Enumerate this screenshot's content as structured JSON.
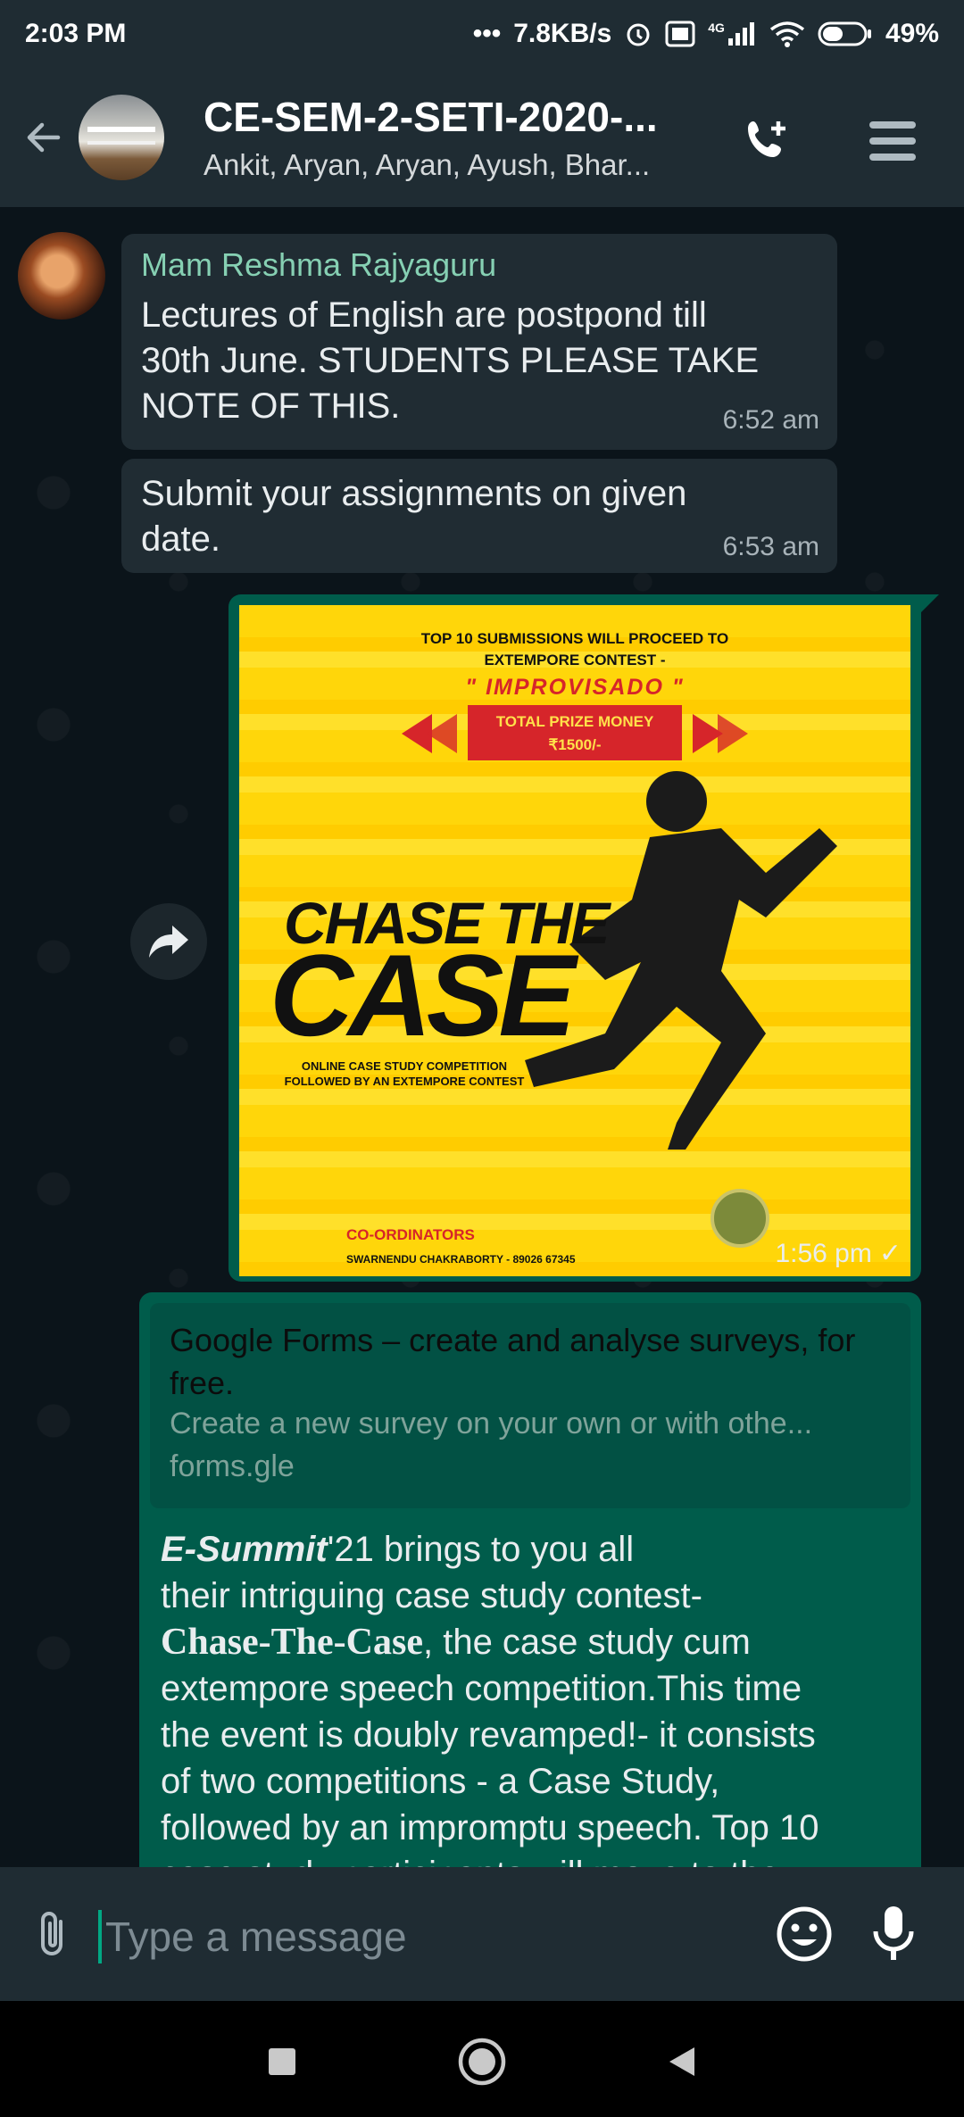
{
  "status_bar": {
    "time": "2:03 PM",
    "network_speed": "7.8KB/s",
    "battery": "49%",
    "icons": [
      "alarm-icon",
      "volte-icon",
      "signal-icon",
      "wifi-icon",
      "battery-icon"
    ],
    "net_label": "4G"
  },
  "header": {
    "title": "CE-SEM-2-SETI-2020-...",
    "subtitle": "Ankit, Aryan, Aryan, Ayush, Bhar..."
  },
  "messages": [
    {
      "sender": "Mam Reshma Rajyaguru",
      "lines": [
        "Lectures of English are postpond till",
        "30th June. STUDENTS PLEASE TAKE",
        "NOTE OF THIS."
      ],
      "time": "6:52 am"
    },
    {
      "lines": [
        "Submit your assignments on given",
        "date."
      ],
      "time": "6:53 am"
    }
  ],
  "image_message": {
    "time": "1:56 pm",
    "status": "✓",
    "poster": {
      "line1": "TOP 10 SUBMISSIONS WILL PROCEED TO",
      "line2": "EXTEMPORE CONTEST -",
      "improvisado": "\" IMPROVISADO \"",
      "prize_label": "TOTAL PRIZE MONEY",
      "prize_amount": "₹1500/-",
      "chase": "CHASE THE",
      "case": "CASE",
      "sub1": "ONLINE CASE STUDY COMPETITION",
      "sub2": "FOLLOWED BY AN EXTEMPORE CONTEST",
      "coordinators": "CO-ORDINATORS",
      "coordinator_name": "SWARNENDU CHAKRABORTY - 89026 67345"
    }
  },
  "link_message": {
    "preview_title": "Google Forms – create and analyse surveys, for free.",
    "preview_desc": "Create a new survey on your own or with othe...",
    "preview_url": "forms.gle",
    "body": {
      "esummit": "E-Summit",
      "l1_rest": "'21 brings to you all",
      "l2": "their intriguing case study contest-",
      "chase": "Chase-The-Case",
      "l3_rest": ", the case study cum",
      "l4": "extempore speech competition.This time",
      "l5": "the event is doubly revamped!- it consists",
      "l6": "of two competitions -  a Case Study,",
      "l7": "followed by an impromptu speech. Top 10",
      "l8": "case study participants will move to the"
    }
  },
  "input": {
    "placeholder": "Type a message"
  },
  "colors": {
    "header_bg": "#1f2c33",
    "incoming_bubble": "#202c33",
    "outgoing_bubble": "#005c4b",
    "sender_name": "#86d0b3",
    "accent": "#00a884"
  }
}
